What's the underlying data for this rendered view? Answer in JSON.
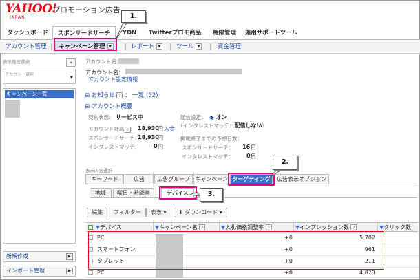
{
  "header": {
    "logo": "YAHOO!",
    "logo_sub": "JAPAN",
    "title": "プロモーション広告"
  },
  "main_tabs": [
    "ダッシュボード",
    "スポンサードサーチ",
    "YDN",
    "Twitterプロモ商品",
    "権限管理",
    "運用サポートツール"
  ],
  "sub_nav": {
    "account": "アカウント管理",
    "campaign": "キャンペーン管理",
    "report": "レポート",
    "tools": "ツール",
    "funds": "資金管理"
  },
  "sidebar": {
    "label": "表示階層選択",
    "account_select": "アカウント選択",
    "tree_item": "キャンペーン一覧",
    "new_button": "新規作成",
    "import_button": "インポート管理"
  },
  "account": {
    "name_label1": "アカウント名：",
    "name_label2": "アカウント名：",
    "settings_link": "アカウント設定情報"
  },
  "notice": {
    "label": "お知らせ",
    "list_link": "一覧 (52)"
  },
  "overview": {
    "title": "アカウント概要",
    "contract_label": "契約状況：",
    "contract_value": "サービス中",
    "balance_label": "アカウント残高",
    "balance_value": "18,930",
    "yen": "円",
    "deposit_link": "入金",
    "ss_label": "スポンサードサーチ：",
    "ss_value": "18,930",
    "im_label": "インタレストマッチ：",
    "im_value": "0",
    "delivery_label": "配信設定：",
    "delivery_on": "オン",
    "im_note": "（インタレストマッチ：",
    "im_note_value": "配信しない",
    "im_note_end": "）",
    "days_label": "掲載終了までの予想日数：",
    "days_ss_label": "スポンサードサーチ：",
    "days_ss_value": "16",
    "days_unit": "日",
    "days_im_label": "インタレストマッチ：",
    "days_im_value": "0"
  },
  "view_label": "表示内容選択",
  "view_tabs": [
    "キーワード",
    "広告",
    "広告グループ",
    "キャンペーン",
    "ターゲティング",
    "広告表示オプション"
  ],
  "sub_tabs": [
    "地域",
    "曜日・時間帯",
    "デバイス"
  ],
  "toolbar": {
    "edit": "編集",
    "filter": "フィルター",
    "display": "表示",
    "download": "ダウンロード"
  },
  "table": {
    "headers": [
      "デバイス",
      "キャンペーン名",
      "入札価格調整率",
      "インプレッション数",
      "クリック数"
    ],
    "rows": [
      {
        "device": "PC",
        "bid": "+0",
        "impressions": "5,702"
      },
      {
        "device": "スマートフォン",
        "bid": "+0",
        "impressions": "961"
      },
      {
        "device": "タブレット",
        "bid": "+0",
        "impressions": "211"
      },
      {
        "device": "PC",
        "bid": "+0",
        "impressions": "4,823"
      }
    ]
  },
  "callouts": [
    "1.",
    "2.",
    "3."
  ],
  "colors": {
    "accent": "#3b6ec9",
    "annotation": "#e6007e",
    "brand": "#e60012"
  }
}
